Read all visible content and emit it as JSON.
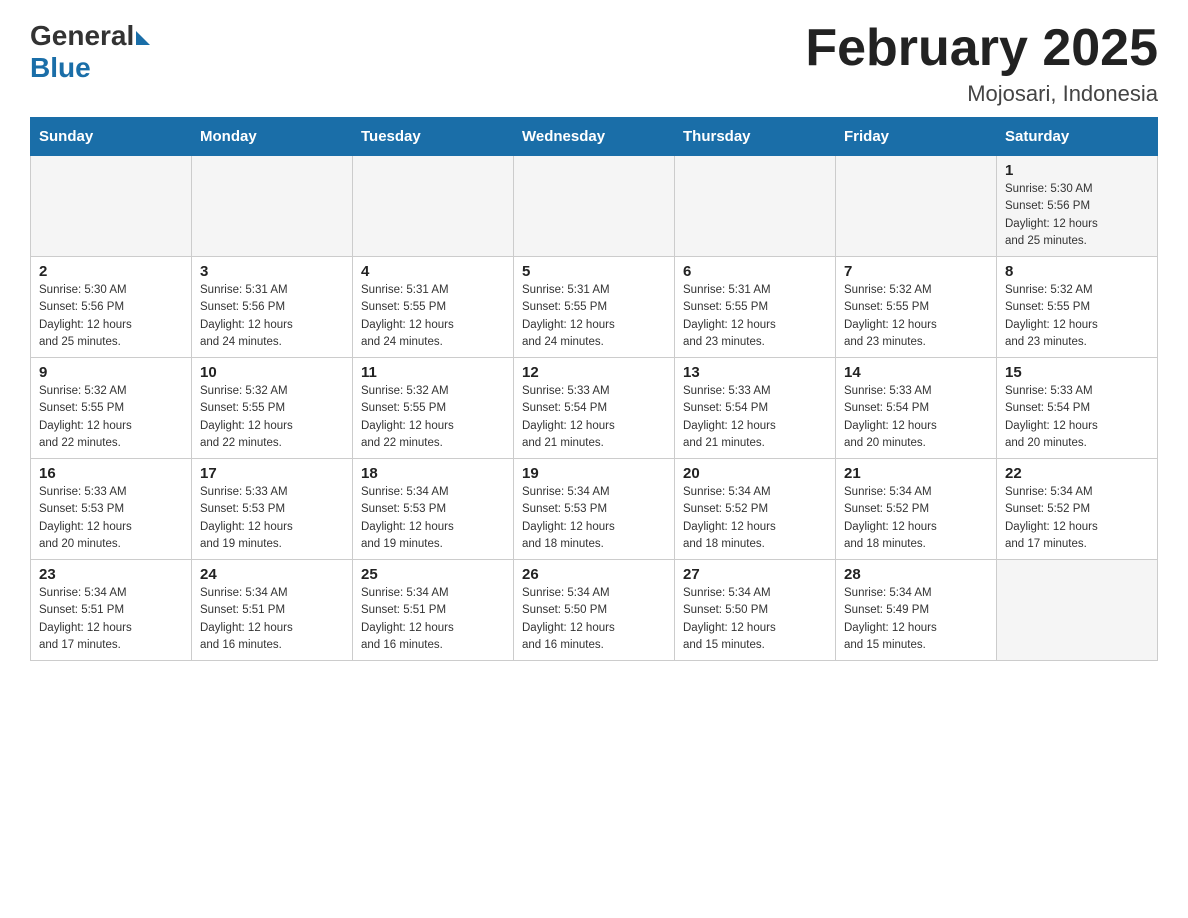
{
  "header": {
    "logo_general": "General",
    "logo_blue": "Blue",
    "month_title": "February 2025",
    "location": "Mojosari, Indonesia"
  },
  "days_of_week": [
    "Sunday",
    "Monday",
    "Tuesday",
    "Wednesday",
    "Thursday",
    "Friday",
    "Saturday"
  ],
  "weeks": [
    [
      {
        "day": "",
        "info": ""
      },
      {
        "day": "",
        "info": ""
      },
      {
        "day": "",
        "info": ""
      },
      {
        "day": "",
        "info": ""
      },
      {
        "day": "",
        "info": ""
      },
      {
        "day": "",
        "info": ""
      },
      {
        "day": "1",
        "info": "Sunrise: 5:30 AM\nSunset: 5:56 PM\nDaylight: 12 hours\nand 25 minutes."
      }
    ],
    [
      {
        "day": "2",
        "info": "Sunrise: 5:30 AM\nSunset: 5:56 PM\nDaylight: 12 hours\nand 25 minutes."
      },
      {
        "day": "3",
        "info": "Sunrise: 5:31 AM\nSunset: 5:56 PM\nDaylight: 12 hours\nand 24 minutes."
      },
      {
        "day": "4",
        "info": "Sunrise: 5:31 AM\nSunset: 5:55 PM\nDaylight: 12 hours\nand 24 minutes."
      },
      {
        "day": "5",
        "info": "Sunrise: 5:31 AM\nSunset: 5:55 PM\nDaylight: 12 hours\nand 24 minutes."
      },
      {
        "day": "6",
        "info": "Sunrise: 5:31 AM\nSunset: 5:55 PM\nDaylight: 12 hours\nand 23 minutes."
      },
      {
        "day": "7",
        "info": "Sunrise: 5:32 AM\nSunset: 5:55 PM\nDaylight: 12 hours\nand 23 minutes."
      },
      {
        "day": "8",
        "info": "Sunrise: 5:32 AM\nSunset: 5:55 PM\nDaylight: 12 hours\nand 23 minutes."
      }
    ],
    [
      {
        "day": "9",
        "info": "Sunrise: 5:32 AM\nSunset: 5:55 PM\nDaylight: 12 hours\nand 22 minutes."
      },
      {
        "day": "10",
        "info": "Sunrise: 5:32 AM\nSunset: 5:55 PM\nDaylight: 12 hours\nand 22 minutes."
      },
      {
        "day": "11",
        "info": "Sunrise: 5:32 AM\nSunset: 5:55 PM\nDaylight: 12 hours\nand 22 minutes."
      },
      {
        "day": "12",
        "info": "Sunrise: 5:33 AM\nSunset: 5:54 PM\nDaylight: 12 hours\nand 21 minutes."
      },
      {
        "day": "13",
        "info": "Sunrise: 5:33 AM\nSunset: 5:54 PM\nDaylight: 12 hours\nand 21 minutes."
      },
      {
        "day": "14",
        "info": "Sunrise: 5:33 AM\nSunset: 5:54 PM\nDaylight: 12 hours\nand 20 minutes."
      },
      {
        "day": "15",
        "info": "Sunrise: 5:33 AM\nSunset: 5:54 PM\nDaylight: 12 hours\nand 20 minutes."
      }
    ],
    [
      {
        "day": "16",
        "info": "Sunrise: 5:33 AM\nSunset: 5:53 PM\nDaylight: 12 hours\nand 20 minutes."
      },
      {
        "day": "17",
        "info": "Sunrise: 5:33 AM\nSunset: 5:53 PM\nDaylight: 12 hours\nand 19 minutes."
      },
      {
        "day": "18",
        "info": "Sunrise: 5:34 AM\nSunset: 5:53 PM\nDaylight: 12 hours\nand 19 minutes."
      },
      {
        "day": "19",
        "info": "Sunrise: 5:34 AM\nSunset: 5:53 PM\nDaylight: 12 hours\nand 18 minutes."
      },
      {
        "day": "20",
        "info": "Sunrise: 5:34 AM\nSunset: 5:52 PM\nDaylight: 12 hours\nand 18 minutes."
      },
      {
        "day": "21",
        "info": "Sunrise: 5:34 AM\nSunset: 5:52 PM\nDaylight: 12 hours\nand 18 minutes."
      },
      {
        "day": "22",
        "info": "Sunrise: 5:34 AM\nSunset: 5:52 PM\nDaylight: 12 hours\nand 17 minutes."
      }
    ],
    [
      {
        "day": "23",
        "info": "Sunrise: 5:34 AM\nSunset: 5:51 PM\nDaylight: 12 hours\nand 17 minutes."
      },
      {
        "day": "24",
        "info": "Sunrise: 5:34 AM\nSunset: 5:51 PM\nDaylight: 12 hours\nand 16 minutes."
      },
      {
        "day": "25",
        "info": "Sunrise: 5:34 AM\nSunset: 5:51 PM\nDaylight: 12 hours\nand 16 minutes."
      },
      {
        "day": "26",
        "info": "Sunrise: 5:34 AM\nSunset: 5:50 PM\nDaylight: 12 hours\nand 16 minutes."
      },
      {
        "day": "27",
        "info": "Sunrise: 5:34 AM\nSunset: 5:50 PM\nDaylight: 12 hours\nand 15 minutes."
      },
      {
        "day": "28",
        "info": "Sunrise: 5:34 AM\nSunset: 5:49 PM\nDaylight: 12 hours\nand 15 minutes."
      },
      {
        "day": "",
        "info": ""
      }
    ]
  ]
}
